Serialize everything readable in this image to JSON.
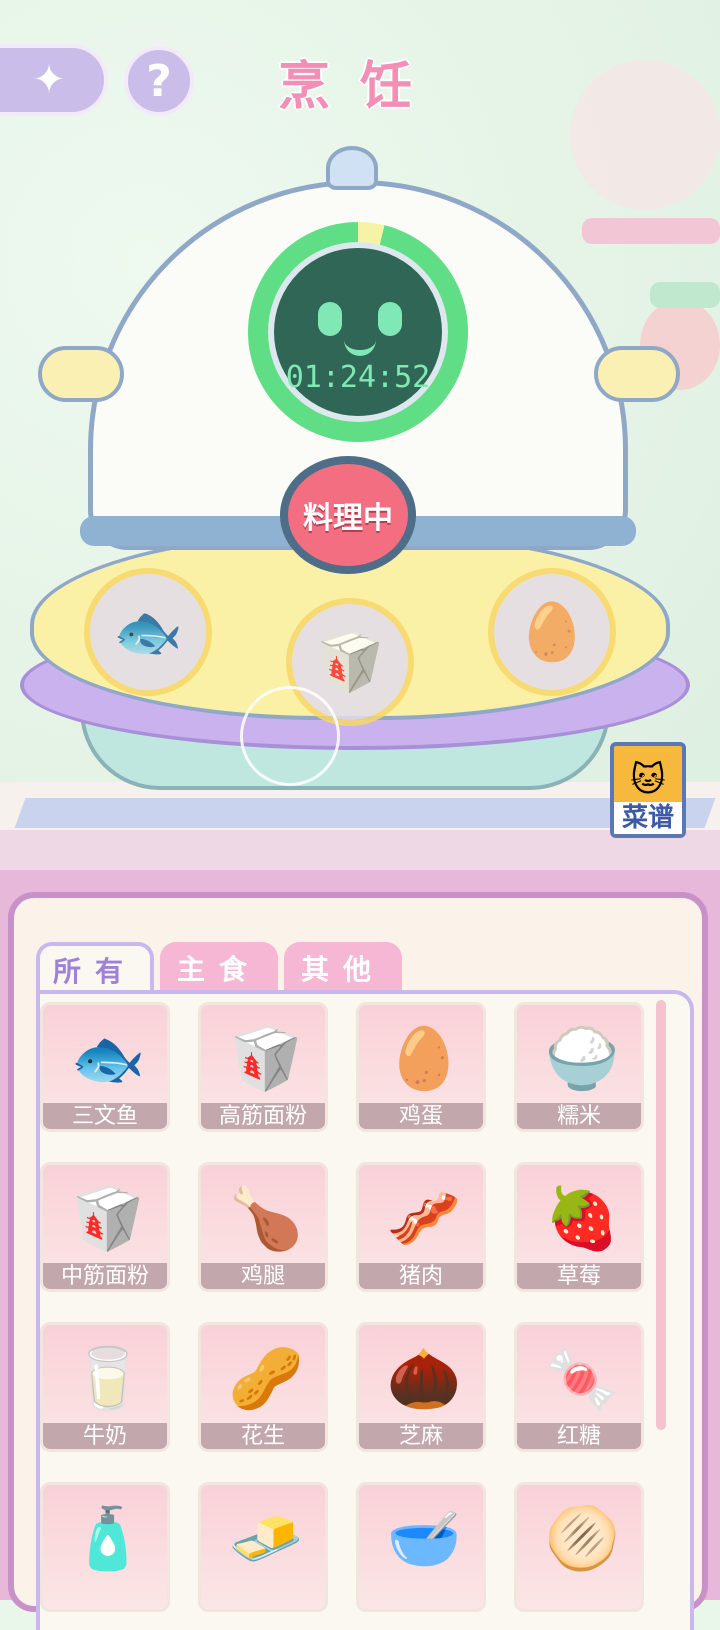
{
  "header": {
    "title": "烹饪",
    "back_icon": "back-arrow-icon",
    "help_label": "?"
  },
  "cooker": {
    "timer": "01:24:52",
    "timer_progress": 0.96,
    "cook_button_label": "料理中",
    "slots": [
      {
        "name": "salmon",
        "icon": "🐟"
      },
      {
        "name": "bread-flour",
        "icon": "🥡"
      },
      {
        "name": "eggs",
        "icon": "🥚"
      }
    ]
  },
  "recipe_button_label": "菜谱",
  "tabs": [
    {
      "label": "所有",
      "active": true
    },
    {
      "label": "主食",
      "active": false
    },
    {
      "label": "其他",
      "active": false
    }
  ],
  "items": [
    {
      "label": "三文鱼",
      "icon": "🐟"
    },
    {
      "label": "高筋面粉",
      "icon": "🥡"
    },
    {
      "label": "鸡蛋",
      "icon": "🥚"
    },
    {
      "label": "糯米",
      "icon": "🍚"
    },
    {
      "label": "中筋面粉",
      "icon": "🥡"
    },
    {
      "label": "鸡腿",
      "icon": "🍗"
    },
    {
      "label": "猪肉",
      "icon": "🥓"
    },
    {
      "label": "草莓",
      "icon": "🍓"
    },
    {
      "label": "牛奶",
      "icon": "🥛"
    },
    {
      "label": "花生",
      "icon": "🥜"
    },
    {
      "label": "芝麻",
      "icon": "🌰"
    },
    {
      "label": "红糖",
      "icon": "🍬"
    },
    {
      "label": "",
      "icon": "🧴"
    },
    {
      "label": "",
      "icon": "🧈"
    },
    {
      "label": "",
      "icon": "🥣"
    },
    {
      "label": "",
      "icon": "🫓"
    }
  ],
  "colors": {
    "accent_pink": "#f38fb5",
    "timer_green": "#7fe8b4",
    "cook_red": "#f36e80"
  }
}
